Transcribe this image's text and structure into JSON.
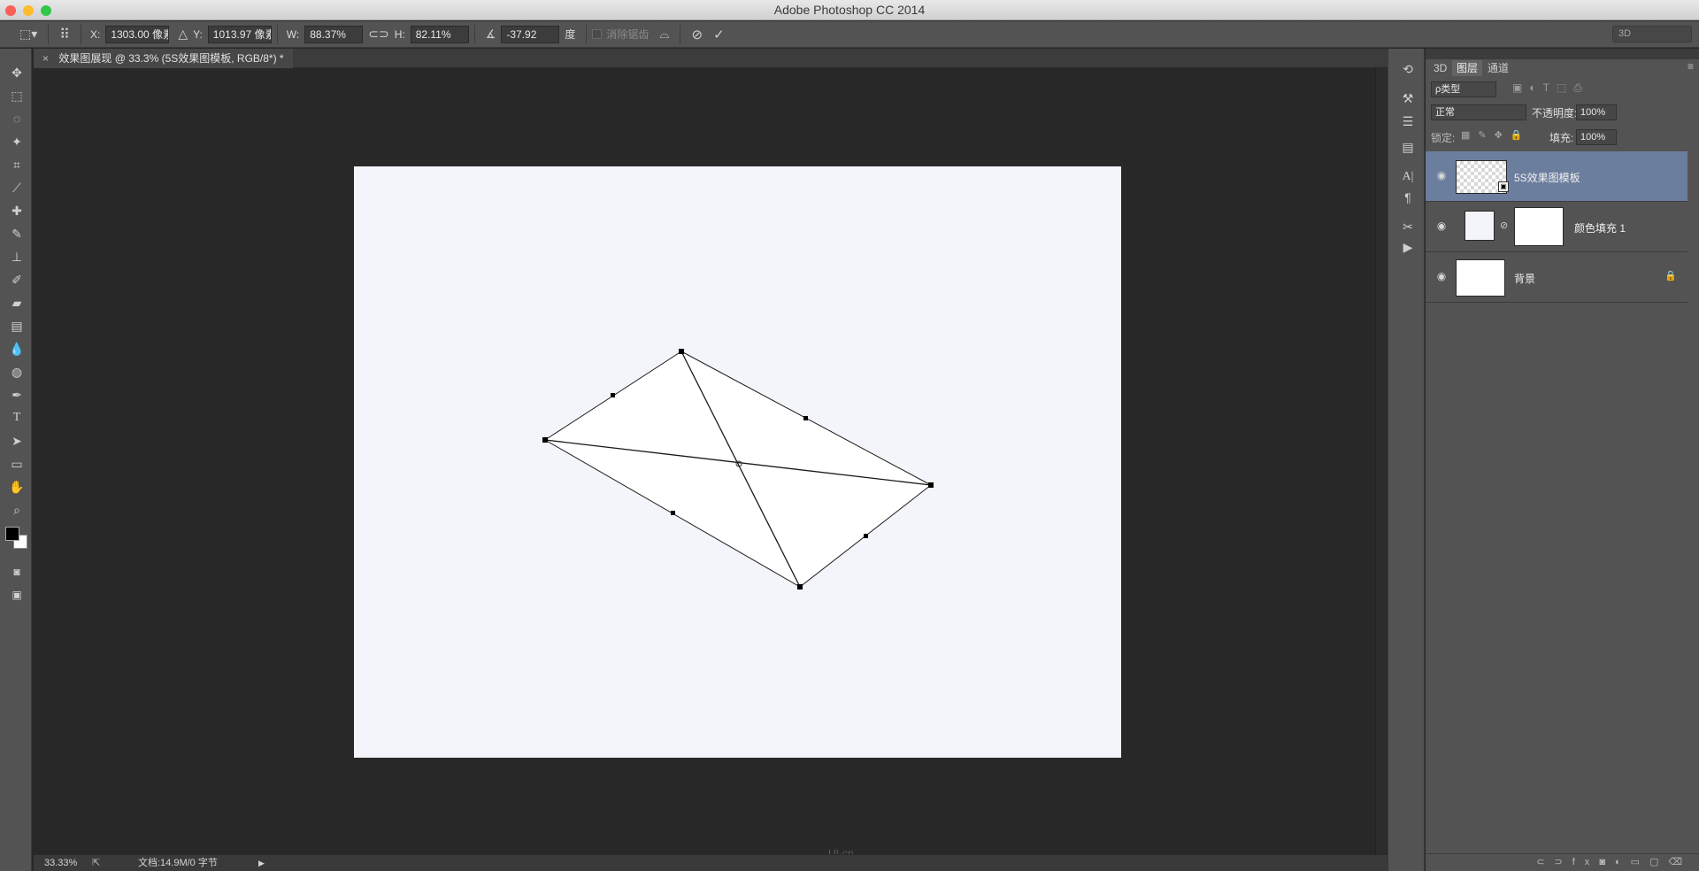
{
  "window": {
    "title": "Adobe Photoshop CC 2014",
    "traffic_colors": [
      "#fc5f57",
      "#fdbc2e",
      "#33c748"
    ]
  },
  "options_bar": {
    "x_label": "X:",
    "x_value": "1303.00 像素",
    "y_label": "Y:",
    "y_value": "1013.97 像素",
    "w_label": "W:",
    "w_value": "88.37%",
    "h_label": "H:",
    "h_value": "82.11%",
    "angle_value": "-37.92",
    "angle_unit": "度",
    "antialias_label": "消除锯齿",
    "workspace": "3D"
  },
  "document": {
    "tab_title": "效果图展现 @ 33.3% (5S效果图模板, RGB/8*) *",
    "zoom": "33.33%",
    "doc_info": "文档:14.9M/0 字节",
    "watermark": "UI·cn"
  },
  "panel": {
    "tabs": [
      "3D",
      "图层",
      "通道"
    ],
    "active_tab": "图层",
    "filter_label": "ρ类型",
    "blend_mode": "正常",
    "opacity_label": "不透明度:",
    "opacity_value": "100%",
    "lock_label": "锁定:",
    "fill_label": "填充:",
    "fill_value": "100%",
    "layers": [
      {
        "name": "5S效果图模板",
        "selected": true
      },
      {
        "name": "颜色填充 1",
        "selected": false
      },
      {
        "name": "背景",
        "selected": false
      }
    ]
  },
  "colors": {
    "selected_layer": "#6c7e9e",
    "canvas_bg": "#f3f5fa"
  }
}
